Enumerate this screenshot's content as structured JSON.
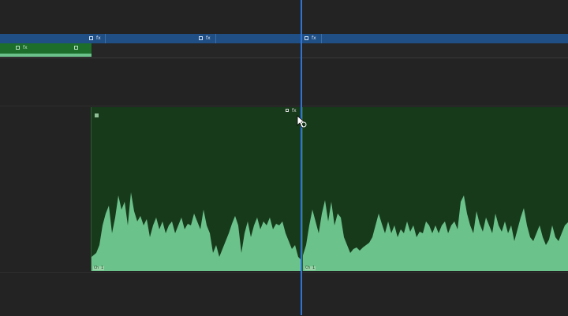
{
  "timeline": {
    "video_track": {
      "clips": [
        {
          "fx_label": "fx"
        },
        {
          "fx_label": "fx"
        },
        {
          "fx_label": "fx"
        }
      ]
    },
    "audio_track_1": {
      "clip": {
        "fx_label": "fx"
      }
    },
    "audio_track_2": {
      "clips": [
        {
          "name": "Ch 1",
          "fx_label": "fx"
        },
        {
          "name": "Ch 1"
        }
      ],
      "colors": {
        "clip_bg": "#173a1b",
        "waveform": "#6cc28b"
      }
    },
    "playhead": {
      "color": "#2e74d6"
    },
    "colors": {
      "video_track": "#1f4f85",
      "background": "#232323"
    }
  }
}
